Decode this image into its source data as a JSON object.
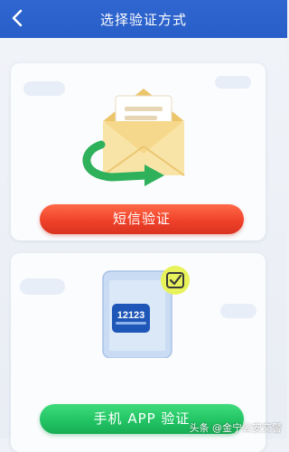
{
  "header": {
    "title": "选择验证方式",
    "back_icon": "chevron-left-icon",
    "background": "#2f66d0"
  },
  "sms_option": {
    "button_label": "短信验证",
    "illustration_icon": "envelope-icon",
    "button_color": "#f0422a"
  },
  "app_option": {
    "button_label": "手机 APP 验证",
    "illustration_icon": "phone-app-icon",
    "app_logo_text": "12123",
    "check_icon": "checkmark-icon",
    "button_color": "#22c464"
  },
  "watermark": "头条 @金宁公安交警"
}
